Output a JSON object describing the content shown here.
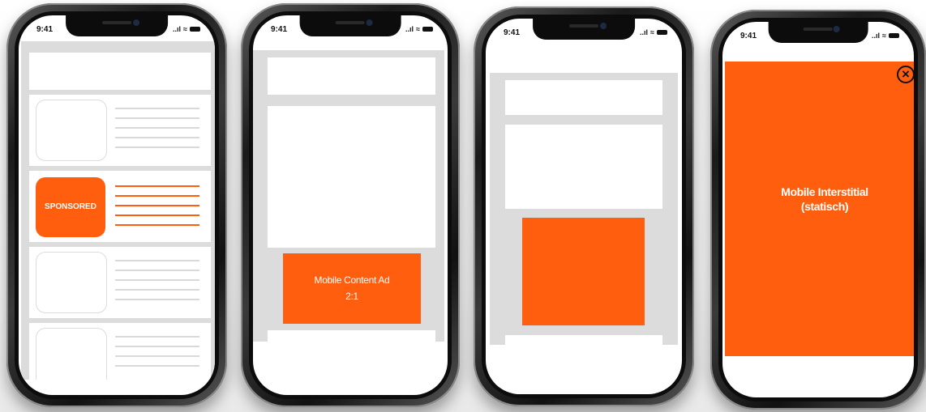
{
  "status_bar": {
    "time": "9:41",
    "signal": "..ıl",
    "wifi": "≈"
  },
  "phones": [
    {
      "id": "native",
      "sponsored_label": "SPONSORED"
    },
    {
      "id": "content-ad",
      "ad_label_line1": "Mobile Content Ad",
      "ad_label_line2": "2:1"
    },
    {
      "id": "rectangle"
    },
    {
      "id": "interstitial",
      "ad_label_line1": "Mobile Interstitial",
      "ad_label_line2": "(statisch)",
      "close_icon": "×"
    }
  ],
  "colors": {
    "accent": "#ff5e0e",
    "placeholder_gray": "#dcdcdc",
    "line_gray": "#d9d9d9"
  }
}
